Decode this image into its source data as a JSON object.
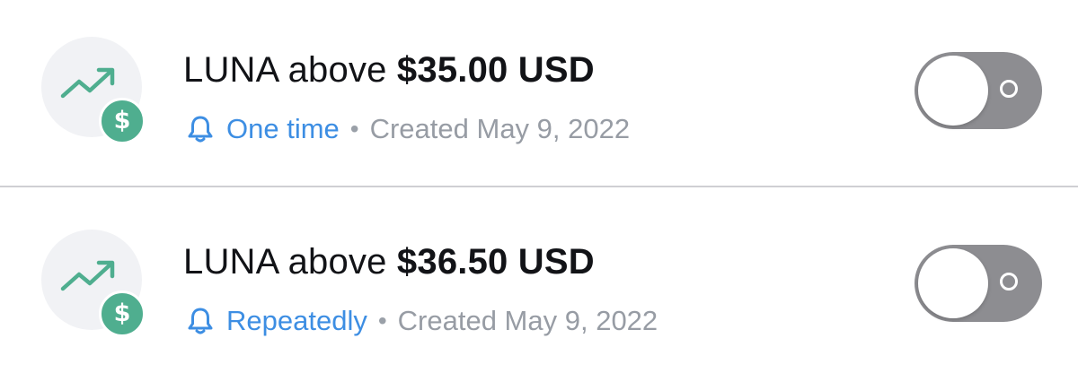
{
  "alerts": [
    {
      "asset": "LUNA above",
      "price": "$35.00 USD",
      "frequency": "One time",
      "separator": "•",
      "created": "Created May 9, 2022",
      "enabled": false
    },
    {
      "asset": "LUNA above",
      "price": "$36.50 USD",
      "frequency": "Repeatedly",
      "separator": "•",
      "created": "Created May 9, 2022",
      "enabled": false
    }
  ],
  "icons": {
    "trend": "trend-up-icon",
    "badge": "dollar-badge-icon",
    "bell": "bell-icon",
    "badge_symbol": "$"
  },
  "colors": {
    "accent": "#3d8ee3",
    "badge_green": "#4fae8f",
    "trend_green": "#4fae8f",
    "toggle_off": "#8d8d91",
    "meta_gray": "#979ca4",
    "title": "#121317"
  }
}
